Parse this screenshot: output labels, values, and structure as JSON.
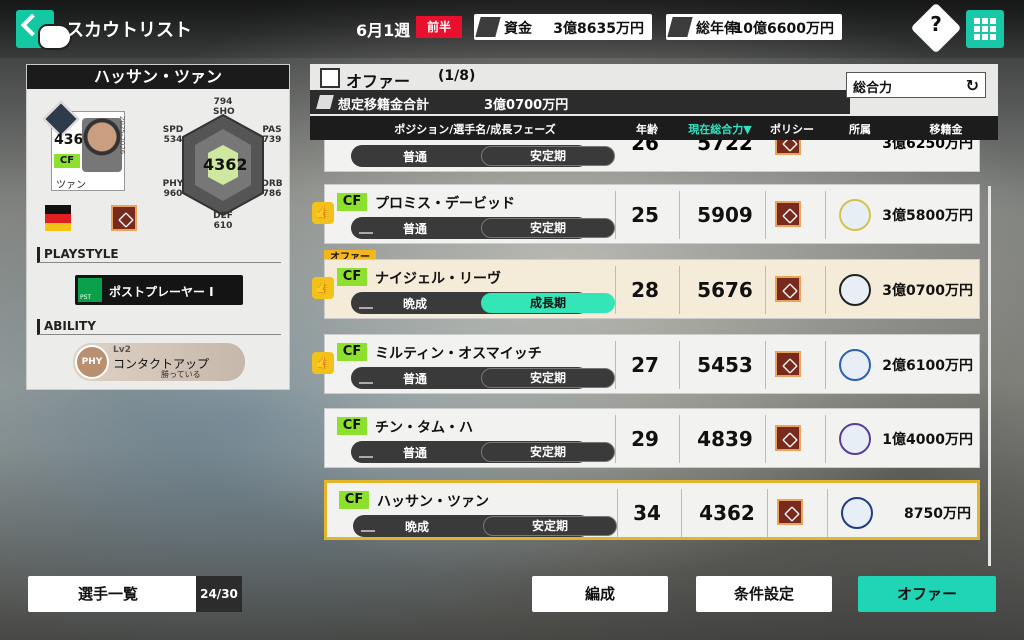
{
  "header": {
    "title": "スカウトリスト",
    "date": "6月1週",
    "half": "前半",
    "funds_label": "資金",
    "funds_value": "3億8635万円",
    "salary_label": "総年俸",
    "salary_value": "10億6600万円",
    "help_label": "?"
  },
  "card": {
    "name": "ハッサン・ツァン",
    "ovr": "4362",
    "position": "CF",
    "small_name": "ツァン",
    "year": "2025-2026",
    "stats": {
      "sho_value": "794",
      "sho_label": "SHO",
      "pas_label": "PAS",
      "pas_value": "739",
      "drb_label": "DRB",
      "drb_value": "786",
      "def_label": "DEF",
      "def_value": "610",
      "phy_label": "PHY",
      "phy_value": "960",
      "spd_label": "SPD",
      "spd_value": "534",
      "center": "4362"
    },
    "playstyle_heading": "PLAYSTYLE",
    "playstyle_icon_text": "PST",
    "playstyle": "ポストプレーヤー I",
    "ability_heading": "ABILITY",
    "ability_badge": "PHY",
    "ability_level": "Lv2",
    "ability_name": "コンタクトアップ",
    "ability_sub": "勝っている"
  },
  "list": {
    "title": "オファー",
    "count": "(1/8)",
    "sum_label": "想定移籍金合計",
    "sum_value": "3億0700万円",
    "sort_label": "総合力",
    "sort_icon": "↻",
    "columns": [
      "ポジション/選手名/成長フェーズ",
      "年齢",
      "現在総合力▼",
      "ポリシー",
      "所属",
      "移籍金"
    ],
    "offer_tag": "オファー",
    "rows": [
      {
        "position": "CF",
        "name": "プロミス・デービッド",
        "type": "普通",
        "phase": "安定期",
        "age": "25",
        "ovr": "5909",
        "fee": "3億5800万円",
        "thumb": true,
        "offered": false,
        "selected": false,
        "phase_hot": false,
        "club_color": "#d8c14a"
      },
      {
        "position": "CF",
        "name": "ナイジェル・リーヴ",
        "type": "晩成",
        "phase": "成長期",
        "age": "28",
        "ovr": "5676",
        "fee": "3億0700万円",
        "thumb": true,
        "offered": true,
        "selected": false,
        "phase_hot": true,
        "club_color": "#222222"
      },
      {
        "position": "CF",
        "name": "ミルティン・オスマイッチ",
        "type": "普通",
        "phase": "安定期",
        "age": "27",
        "ovr": "5453",
        "fee": "2億6100万円",
        "thumb": true,
        "offered": false,
        "selected": false,
        "phase_hot": false,
        "club_color": "#2e5fb0"
      },
      {
        "position": "CF",
        "name": "チン・タム・ハ",
        "type": "普通",
        "phase": "安定期",
        "age": "29",
        "ovr": "4839",
        "fee": "1億4000万円",
        "thumb": false,
        "offered": false,
        "selected": false,
        "phase_hot": false,
        "club_color": "#5a3e96"
      },
      {
        "position": "CF",
        "name": "ハッサン・ツァン",
        "type": "晩成",
        "phase": "安定期",
        "age": "34",
        "ovr": "4362",
        "fee": "8750万円",
        "thumb": false,
        "offered": false,
        "selected": true,
        "phase_hot": false,
        "club_color": "#1f3c86"
      }
    ],
    "partial_row": {
      "type": "普通",
      "phase": "安定期",
      "age": "26",
      "ovr": "5722",
      "fee": "3億6250万円"
    }
  },
  "footer": {
    "player_list": "選手一覧",
    "player_count": "24/30",
    "formation": "編成",
    "conditions": "条件設定",
    "offer": "オファー"
  },
  "colors": {
    "accent": "#20d4b6",
    "position_badge": "#8ee02f",
    "offer_tag": "#f4b61b",
    "selected_border": "#e3b52b",
    "half_badge": "#e8112d"
  }
}
